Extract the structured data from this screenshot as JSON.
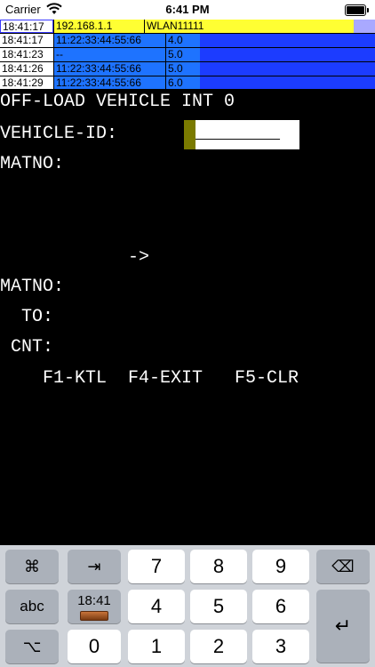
{
  "status_bar": {
    "carrier": "Carrier",
    "time": "6:41 PM",
    "wifi_icon": "wifi-icon",
    "battery_icon": "battery-icon"
  },
  "log": {
    "rows": [
      {
        "time": "18:41:17",
        "col2": "192.168.1.1",
        "col3": "WLAN11111"
      },
      {
        "time": "18:41:17",
        "col2": "11:22:33:44:55:66",
        "col3": "4.0"
      },
      {
        "time": "18:41:23",
        "col2": "--",
        "col3": "5.0"
      },
      {
        "time": "18:41:26",
        "col2": "11:22:33:44:55:66",
        "col3": "5.0"
      },
      {
        "time": "18:41:29",
        "col2": "11:22:33:44:55:66",
        "col3": "6.0"
      }
    ]
  },
  "terminal": {
    "title": "OFF-LOAD VEHICLE INT 0",
    "vehicle_id_label": "VEHICLE-ID:",
    "vehicle_id_value": "_________",
    "matno1_label": "MATNO:",
    "arrow": "->",
    "matno2_label": "MATNO:",
    "to_label": "  TO:",
    "cnt_label": " CNT:",
    "fkeys": "    F1-KTL  F4-EXIT   F5-CLR"
  },
  "keyboard": {
    "cmd": "⌘",
    "tab": "⇥",
    "abc": "abc",
    "alt": "⌥",
    "time": "18:41",
    "backspace": "⌫",
    "enter": "↵",
    "digits": [
      "7",
      "8",
      "9",
      "4",
      "5",
      "6",
      "0",
      "1",
      "2",
      "3"
    ]
  },
  "colors": {
    "yellow": "#ffff33",
    "blue": "#1e73ff",
    "dark_blue": "#1c3cff",
    "cursor": "#7a7a00"
  }
}
